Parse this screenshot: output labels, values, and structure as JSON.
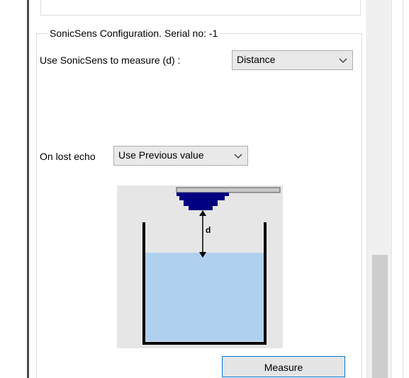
{
  "group": {
    "title": "SonicSens Configuration. Serial no: -1"
  },
  "measure_row": {
    "label": "Use SonicSens to measure (d) :",
    "selected": "Distance"
  },
  "lost_echo_row": {
    "label": "On lost echo",
    "selected": "Use Previous value"
  },
  "diagram": {
    "distance_label": "d",
    "liquid_color": "#b0d0f0",
    "sensor_color": "#000080"
  },
  "buttons": {
    "measure": "Measure"
  },
  "colors": {
    "focus_border": "#0078d7",
    "control_bg": "#e9e9e9"
  }
}
